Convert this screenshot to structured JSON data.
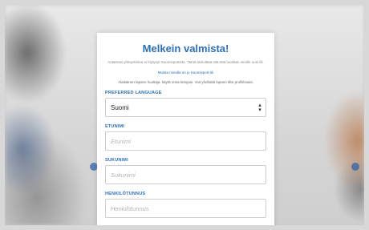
{
  "form": {
    "title": "Melkein valmista!",
    "subtitle": "Antamasi yhteystietoa ei löytynyt Suomisportista. Tämä tarkoittaa sitä että luodaan sinulle uusi tili.",
    "link": "Muista minulla on jo Suomisport-tili",
    "note": "Alaikäinen lapsen huoltaja: käytä omia tietojasi. Voit yhdistää lapsen tilisi profiilissasi.",
    "language_label": "PREFERRED LANGUAGE",
    "language_value": "Suomi",
    "firstname_label": "ETUNIMI",
    "firstname_placeholder": "Etunimi",
    "lastname_label": "SUKUNIMI",
    "lastname_placeholder": "Sukunimi",
    "ssn_label": "HENKILÖTUNNUS",
    "ssn_placeholder": "Henkilötunnus"
  },
  "colors": {
    "accent": "#2a6fb8"
  },
  "icons": {
    "select": "chevron-updown-icon"
  }
}
